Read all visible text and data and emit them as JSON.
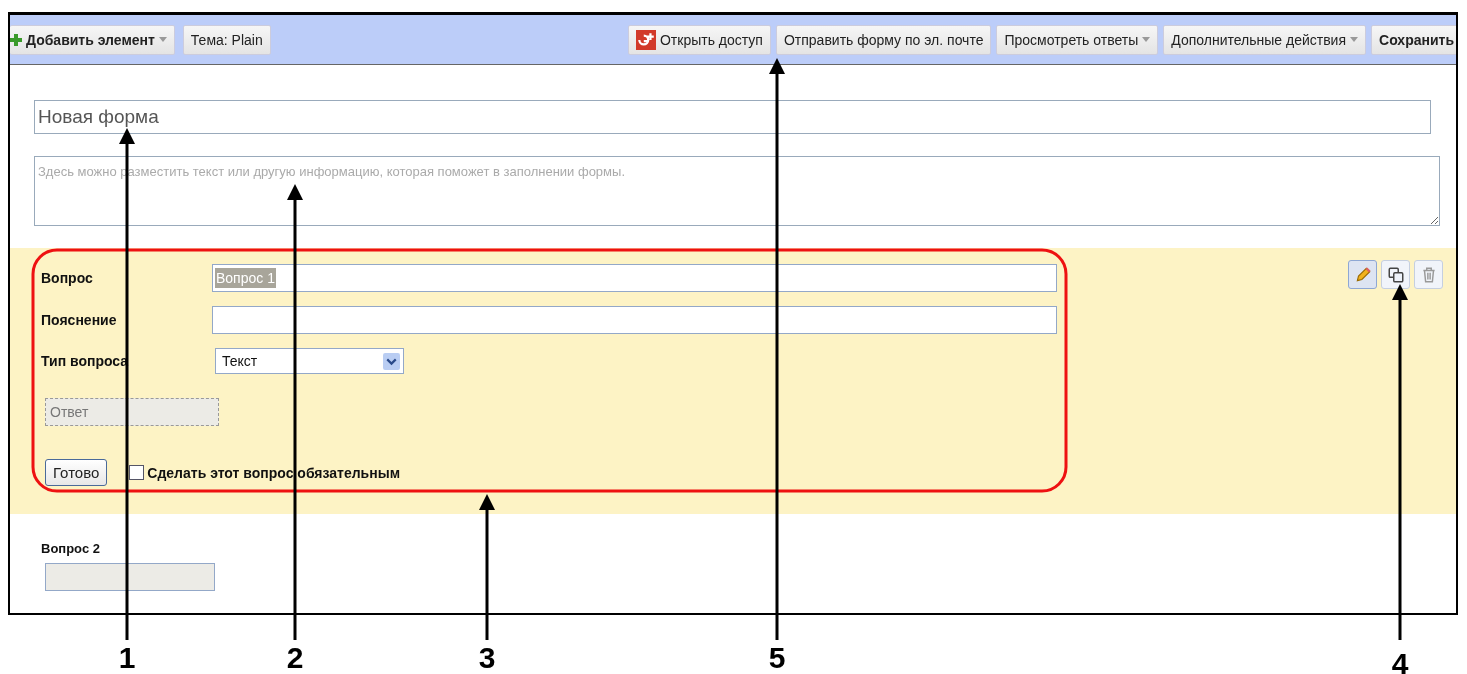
{
  "toolbar": {
    "left": [
      {
        "label": "Добавить элемент",
        "kind": "add"
      },
      {
        "label": "Тема:  Plain",
        "kind": "plain"
      }
    ],
    "right": [
      {
        "label": "Открыть доступ",
        "kind": "share"
      },
      {
        "label": "Отправить форму по эл. почте",
        "kind": "plain"
      },
      {
        "label": "Просмотреть ответы",
        "kind": "menu"
      },
      {
        "label": "Дополнительные действия",
        "kind": "menu"
      },
      {
        "label": "Сохранить",
        "kind": "primary"
      }
    ]
  },
  "form": {
    "title": "Новая форма",
    "description_placeholder": "Здесь можно разместить текст или другую информацию, которая поможет в заполнении формы."
  },
  "question_editor": {
    "title_label": "Вопрос",
    "title_value": "Вопрос 1",
    "title_selected": true,
    "help_label": "Пояснение",
    "type_label": "Тип вопроса",
    "type_value": "Текст",
    "answer_preview": "Ответ",
    "done_button": "Готово",
    "required": {
      "label": "Сделать этот вопрос обязательным",
      "checked": false
    },
    "actions": [
      {
        "kind": "edit",
        "selected": true
      },
      {
        "kind": "copy",
        "selected": false
      },
      {
        "kind": "delete",
        "selected": false
      }
    ]
  },
  "question_2": {
    "title": "Вопрос 2"
  },
  "annotations": [
    {
      "label": "1"
    },
    {
      "label": "2"
    },
    {
      "label": "3"
    },
    {
      "label": "5"
    },
    {
      "label": "4"
    }
  ]
}
